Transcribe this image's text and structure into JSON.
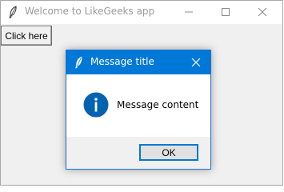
{
  "window": {
    "title": "Welcome to LikeGeeks app",
    "icon": "feather-icon",
    "controls": [
      "minimize-icon",
      "maximize-icon",
      "close-icon"
    ]
  },
  "main": {
    "button_label": "Click here"
  },
  "dialog": {
    "title": "Message title",
    "icon": "feather-icon",
    "message": "Message content",
    "message_icon": "info-icon",
    "ok_label": "OK",
    "accent": "#0078d7"
  },
  "colors": {
    "titlebar_bg": "#ffffff",
    "client_bg": "#f0f0f0",
    "dialog_titlebar_bg": "#0078d7",
    "info_icon_fill": "#0063b1"
  }
}
